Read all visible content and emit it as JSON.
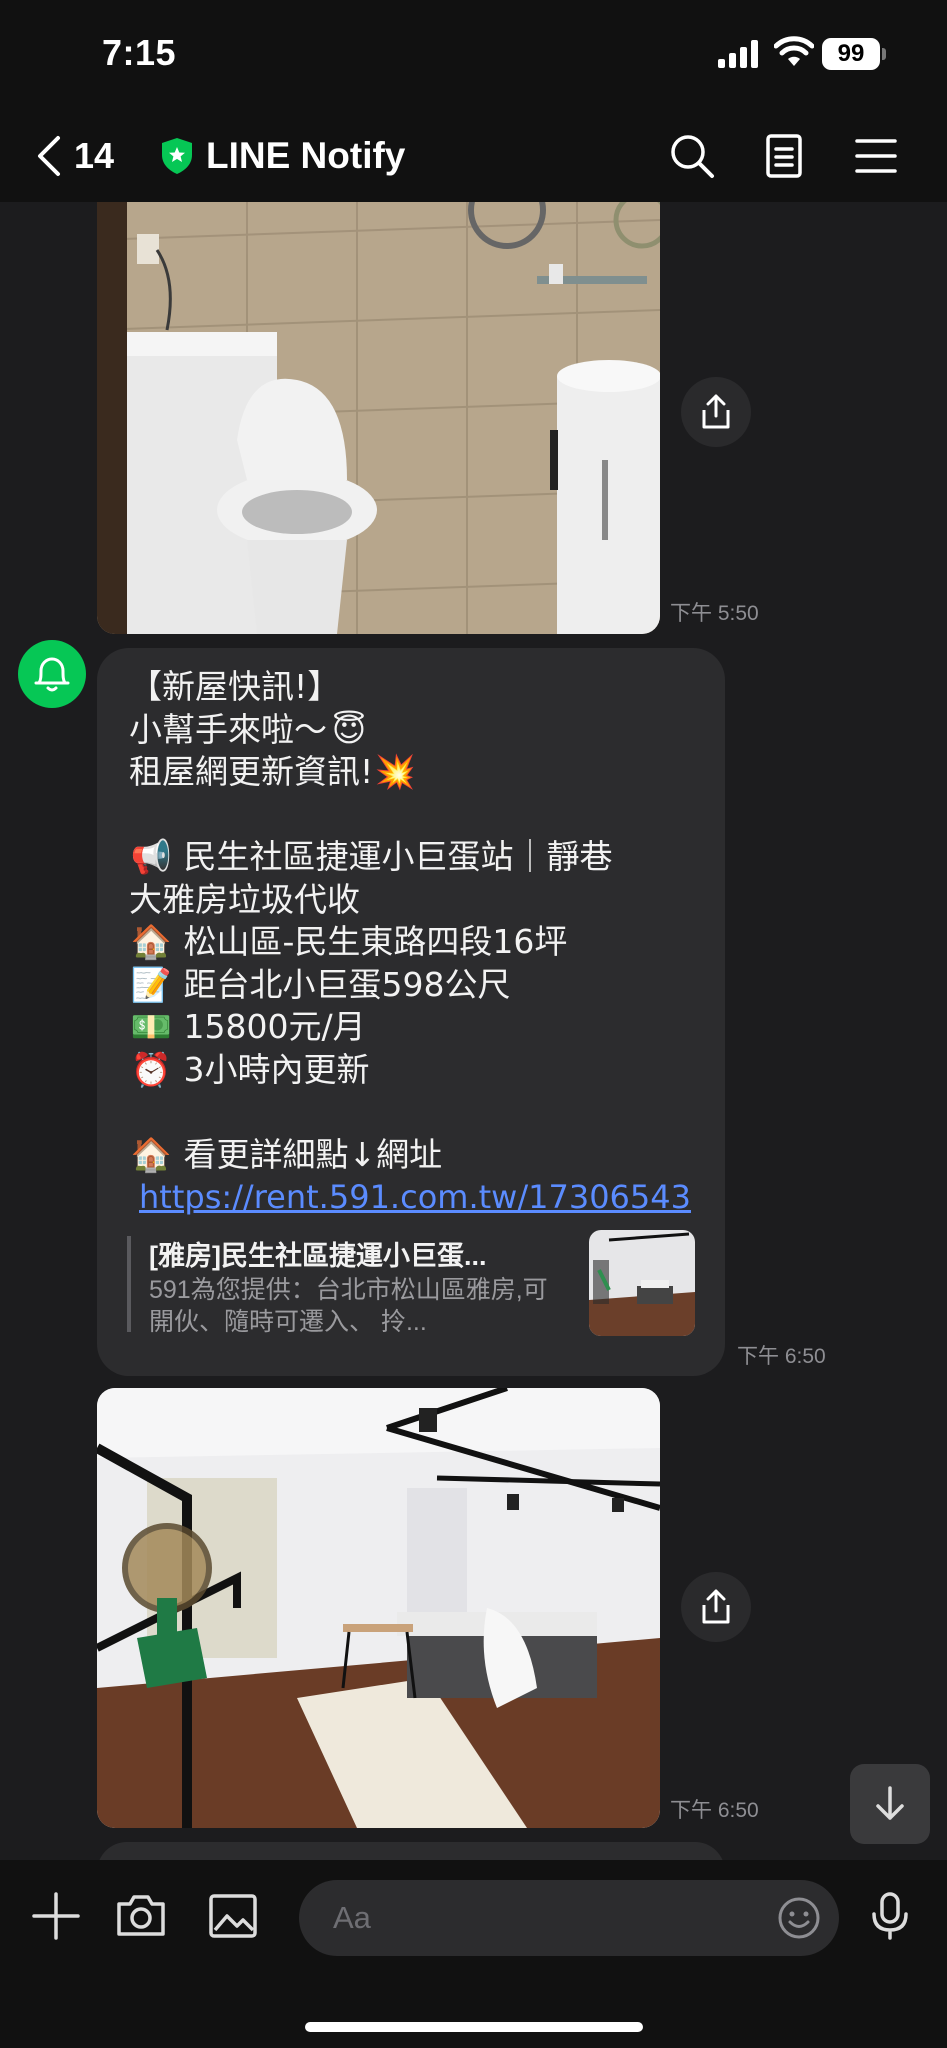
{
  "status_bar": {
    "time": "7:15",
    "battery": "99"
  },
  "header": {
    "back_count": "14",
    "title": "LINE Notify"
  },
  "messages": {
    "photo1_time": "下午 5:50",
    "notify": {
      "lines": [
        "【新屋快訊!】",
        "小幫手來啦～",
        "租屋網更新資訊!",
        "民生社區捷運小巨蛋站｜靜巷",
        "大雅房垃圾代收",
        "松山區-民生東路四段16坪",
        "距台北小巨蛋598公尺",
        "15800元/月",
        "3小時內更新",
        "看更詳細點↓網址"
      ],
      "emojis": [
        "😇",
        "💥",
        "📢",
        "🏠",
        "📝",
        "💵",
        "⏰",
        "🏠"
      ],
      "link": "https://rent.591.com.tw/17306543",
      "preview_title": "[雅房]民生社區捷運小巨蛋...",
      "preview_desc": "591為您提供：台北市松山區雅房,可開伙、隨時可遷入、 拎...",
      "time": "下午 6:50"
    },
    "photo2_time": "下午 6:50"
  },
  "input": {
    "placeholder": "Aa"
  },
  "colors": {
    "line_green": "#06c755",
    "link_blue": "#5b8cff",
    "bubble": "#2c2c2e"
  }
}
